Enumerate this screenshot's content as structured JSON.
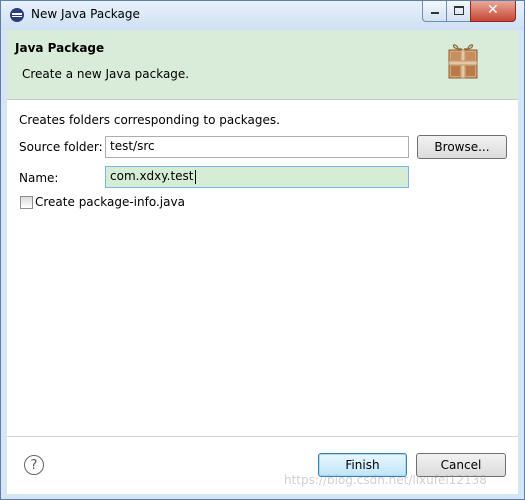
{
  "window": {
    "title": "New Java Package"
  },
  "header": {
    "title": "Java Package",
    "description": "Create a new Java package."
  },
  "form": {
    "intro": "Creates folders corresponding to packages.",
    "source_folder_label": "Source folder:",
    "source_folder_value": "test/src",
    "browse_label": "Browse...",
    "name_label": "Name:",
    "name_value": "com.xdxy.test",
    "checkbox_label": "Create package-info.java",
    "checkbox_checked": false
  },
  "footer": {
    "finish_label": "Finish",
    "cancel_label": "Cancel"
  },
  "watermark": "https://blog.csdn.net/lixufei12138",
  "colors": {
    "header_bg": "#d9ecd9",
    "field_focus": "#d5ecd5",
    "default_button": "#bee6fd"
  }
}
